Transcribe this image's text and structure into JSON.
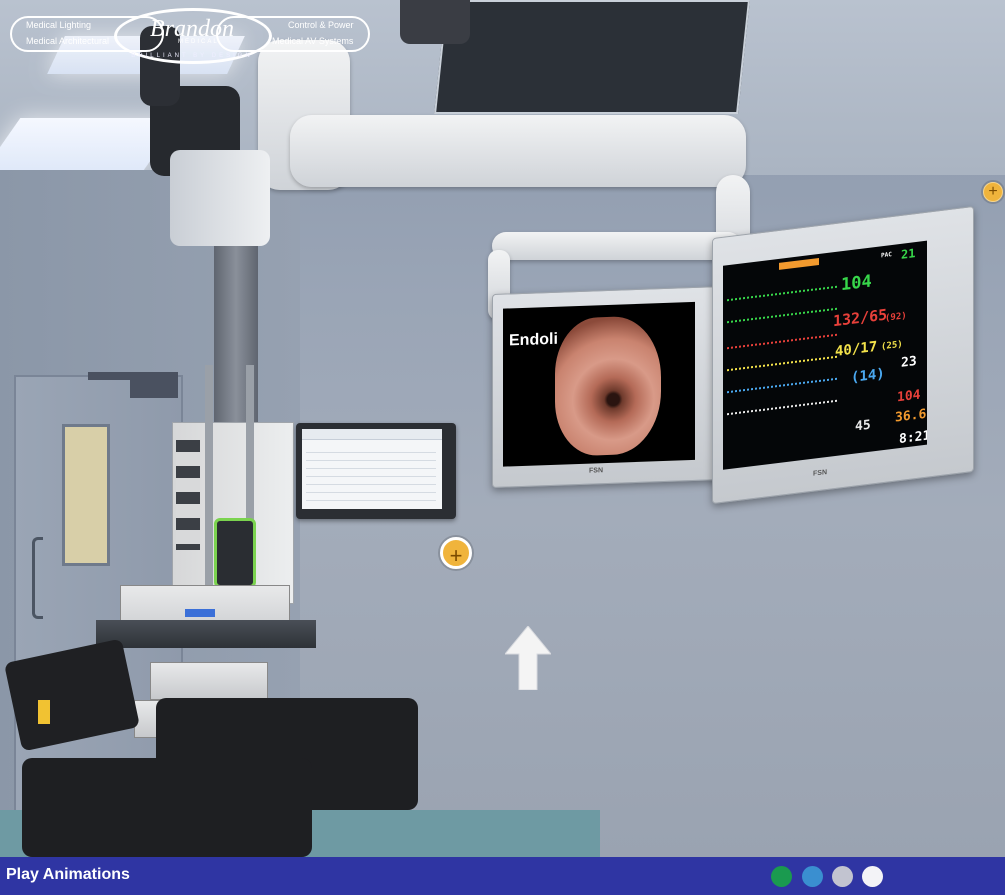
{
  "brand": {
    "left_top": "Medical Lighting",
    "left_bottom": "Medical Architectural",
    "right_top": "Control & Power",
    "right_bottom": "Medical AV Systems",
    "name": "Brandon",
    "sub": "MEDICAL",
    "tagline": "BRILLIANT BY DESIGN"
  },
  "monitor_left": {
    "logo": "Endoli",
    "maker": "FSN"
  },
  "monitor_right": {
    "maker": "FSN",
    "vitals": {
      "hr": "104",
      "bp": "132/65",
      "bp_extra": "(92)",
      "pap": "40/17",
      "pap_extra": "(25)",
      "cvp": "(14)",
      "spo2": "45",
      "rr": "23",
      "etco2_top": "104",
      "temp": "36.6",
      "time": "8:21",
      "label_top": "PAC",
      "value_top": "21"
    }
  },
  "hotspots": {
    "right_edge": "+",
    "center": "+"
  },
  "bottom_bar": {
    "play_label": "Play Animations",
    "dots": [
      "#1a9a4f",
      "#3a8fd0",
      "#c2c4d0",
      "#f3f3f7"
    ]
  },
  "colors": {
    "bar": "#2f35a3",
    "hotspot": "#f0b43c"
  }
}
